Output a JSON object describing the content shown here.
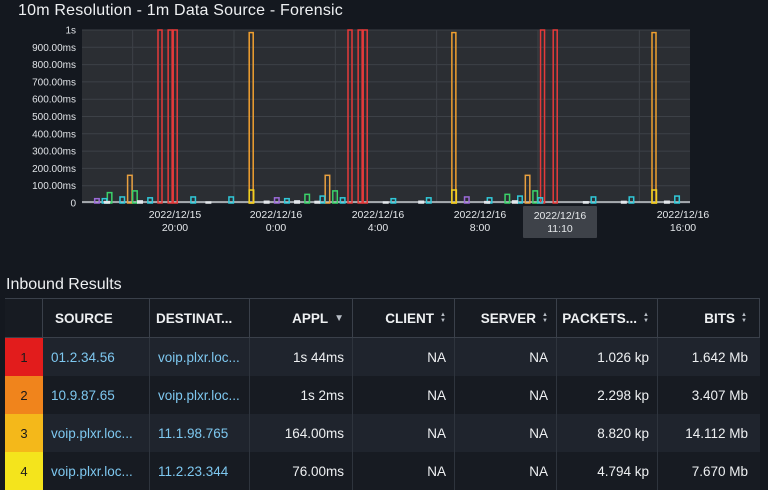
{
  "chart_title": "10m Resolution - 1m Data Source - Forensic",
  "chart_data": {
    "type": "bar",
    "title": "10m Resolution - 1m Data Source - Forensic",
    "y_tick_labels": [
      "1s",
      "900.00ms",
      "800.00ms",
      "700.00ms",
      "600.00ms",
      "500.00ms",
      "400.00ms",
      "300.00ms",
      "200.00ms",
      "100.00ms",
      "0"
    ],
    "ylim": [
      0,
      1000
    ],
    "x_tick_labels": [
      {
        "date": "2022/12/15",
        "time": "20:00"
      },
      {
        "date": "2022/12/16",
        "time": "0:00"
      },
      {
        "date": "2022/12/16",
        "time": "4:00"
      },
      {
        "date": "2022/12/16",
        "time": "8:00"
      },
      {
        "date": "2022/12/16",
        "time": "16:00"
      }
    ],
    "hover_label": {
      "date": "2022/12/16",
      "time": "11:10"
    },
    "grid": true,
    "series": [
      {
        "color": "#e53a3a",
        "x": [
          3.0,
          3.4,
          3.6,
          10.5,
          10.9,
          11.1,
          18.1,
          18.6
        ],
        "values": [
          1000,
          1000,
          1000,
          1000,
          1000,
          1000,
          1000,
          1000
        ]
      },
      {
        "color": "#f0a030",
        "x": [
          6.6,
          14.6,
          22.5
        ],
        "values": [
          985,
          985,
          985
        ]
      },
      {
        "color": "#e8a040",
        "x": [
          1.8,
          9.6,
          17.5
        ],
        "values": [
          160,
          160,
          160
        ]
      },
      {
        "color": "#f0d020",
        "x": [
          6.6,
          14.6,
          22.5
        ],
        "values": [
          75,
          75,
          75
        ]
      },
      {
        "color": "#3bd36a",
        "x": [
          1.0,
          2.0,
          8.8,
          9.9,
          16.7,
          17.8
        ],
        "values": [
          60,
          70,
          50,
          70,
          50,
          70
        ]
      },
      {
        "color": "#30c8d8",
        "x": [
          0.8,
          1.5,
          2.6,
          4.3,
          5.8,
          8.0,
          9.4,
          10.2,
          12.2,
          13.6,
          16.0,
          17.2,
          18.0,
          20.1,
          21.6,
          23.4
        ],
        "values": [
          25,
          35,
          30,
          35,
          35,
          25,
          40,
          30,
          25,
          30,
          30,
          40,
          30,
          35,
          35,
          40
        ]
      },
      {
        "color": "#9b6ad8",
        "x": [
          0.5,
          7.6,
          15.1
        ],
        "values": [
          25,
          30,
          35
        ]
      },
      {
        "color": "#e3e7ec",
        "x": [
          0.9,
          2.2,
          4.9,
          7.2,
          8.4,
          9.2,
          11.9,
          13.3,
          15.9,
          17.0,
          19.8,
          21.3,
          23.0
        ],
        "values": [
          8,
          12,
          6,
          10,
          12,
          9,
          6,
          10,
          8,
          12,
          7,
          9,
          10
        ]
      }
    ]
  },
  "section_title": "Inbound Results",
  "table": {
    "headers": [
      "SOURCE",
      "DESTINAT...",
      "APPL",
      "CLIENT",
      "SERVER",
      "PACKETS...",
      "BITS"
    ],
    "sort_icons": [
      "",
      "",
      "sort-desc-icon",
      "sort-both-icon",
      "sort-both-icon",
      "sort-both-icon",
      "sort-both-icon"
    ],
    "rank_colors": [
      "#e21c1c",
      "#f0841c",
      "#f4b81a",
      "#f4e41c"
    ],
    "rows": [
      {
        "rank": "1",
        "source": "01.2.34.56",
        "destination": "voip.plxr.loc...",
        "appl": "1s 44ms",
        "client": "NA",
        "server": "NA",
        "packets": "1.026 kp",
        "bits": "1.642 Mb"
      },
      {
        "rank": "2",
        "source": "10.9.87.65",
        "destination": "voip.plxr.loc...",
        "appl": "1s 2ms",
        "client": "NA",
        "server": "NA",
        "packets": "2.298 kp",
        "bits": "3.407 Mb"
      },
      {
        "rank": "3",
        "source": "voip.plxr.loc...",
        "destination": "11.1.98.765",
        "appl": "164.00ms",
        "client": "NA",
        "server": "NA",
        "packets": "8.820 kp",
        "bits": "14.112 Mb"
      },
      {
        "rank": "4",
        "source": "voip.plxr.loc...",
        "destination": "11.2.23.344",
        "appl": "76.00ms",
        "client": "NA",
        "server": "NA",
        "packets": "4.794 kp",
        "bits": "7.670 Mb"
      }
    ]
  }
}
